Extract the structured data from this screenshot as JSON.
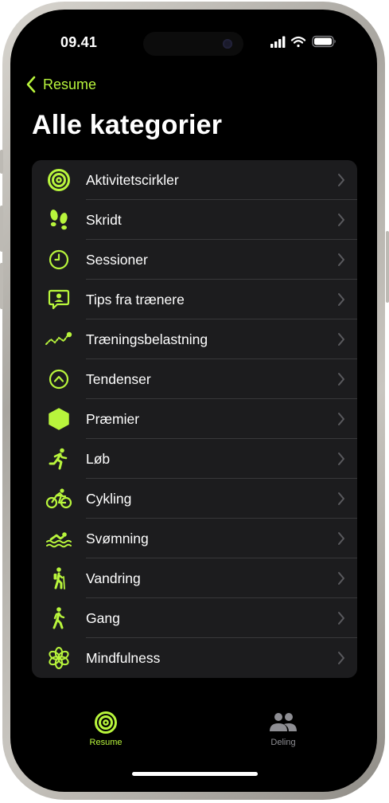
{
  "status_bar": {
    "time": "09.41"
  },
  "nav": {
    "back_label": "Resume"
  },
  "page": {
    "title": "Alle kategorier"
  },
  "theme": {
    "accent": "#b8f53c",
    "background": "#000000",
    "card": "#1c1c1e",
    "separator": "#38383a"
  },
  "categories": [
    {
      "label": "Aktivitetscirkler",
      "icon": "activity-rings-icon"
    },
    {
      "label": "Skridt",
      "icon": "footprints-icon"
    },
    {
      "label": "Sessioner",
      "icon": "clock-icon"
    },
    {
      "label": "Tips fra trænere",
      "icon": "trainer-tips-icon"
    },
    {
      "label": "Træningsbelastning",
      "icon": "training-load-icon"
    },
    {
      "label": "Tendenser",
      "icon": "trends-icon"
    },
    {
      "label": "Præmier",
      "icon": "awards-icon"
    },
    {
      "label": "Løb",
      "icon": "running-icon"
    },
    {
      "label": "Cykling",
      "icon": "cycling-icon"
    },
    {
      "label": "Svømning",
      "icon": "swimming-icon"
    },
    {
      "label": "Vandring",
      "icon": "hiking-icon"
    },
    {
      "label": "Gang",
      "icon": "walking-icon"
    },
    {
      "label": "Mindfulness",
      "icon": "mindfulness-icon"
    }
  ],
  "tab_bar": {
    "tabs": [
      {
        "label": "Resume",
        "icon": "activity-rings-icon",
        "active": true
      },
      {
        "label": "Deling",
        "icon": "people-icon",
        "active": false
      }
    ]
  }
}
